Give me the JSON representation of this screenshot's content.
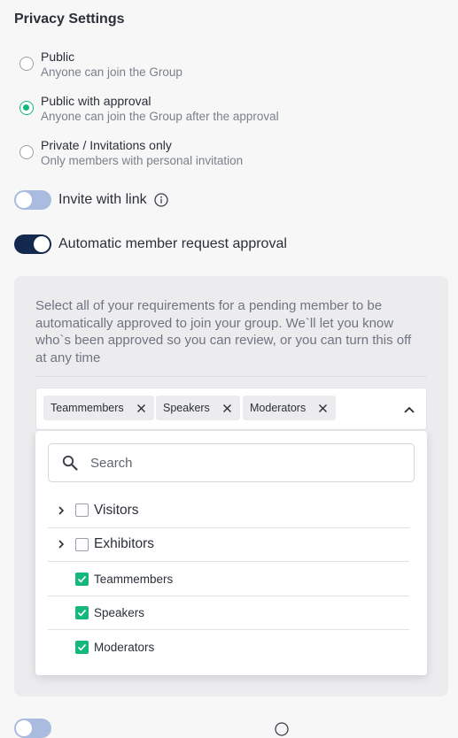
{
  "privacy": {
    "title": "Privacy Settings",
    "options": [
      {
        "title": "Public",
        "description": "Anyone can join the Group",
        "selected": false
      },
      {
        "title": "Public with approval",
        "description": "Anyone can join the Group after the approval",
        "selected": true
      },
      {
        "title": "Private / Invitations only",
        "description": "Only members with personal invitation",
        "selected": false
      }
    ]
  },
  "toggles": {
    "invite_with_link": {
      "label": "Invite with link",
      "on": false
    },
    "auto_approval": {
      "label": "Automatic member request approval",
      "on": true
    }
  },
  "approval_panel": {
    "description": "Select all of your requirements for a pending member to be automatically approved to join your group. We`ll let you know who`s been approved so you can review, or you can turn this off at any time",
    "selected_tags": [
      "Teammembers",
      "Speakers",
      "Moderators"
    ],
    "dropdown": {
      "search_placeholder": "Search",
      "items": [
        {
          "label": "Visitors",
          "checked": false,
          "expandable": true
        },
        {
          "label": "Exhibitors",
          "checked": false,
          "expandable": true
        },
        {
          "label": "Teammembers",
          "checked": true,
          "expandable": false
        },
        {
          "label": "Speakers",
          "checked": true,
          "expandable": false
        },
        {
          "label": "Moderators",
          "checked": true,
          "expandable": false
        }
      ]
    }
  },
  "colors": {
    "accent_green": "#14b87a",
    "toggle_on": "#13284f",
    "toggle_off": "#a9bce0"
  }
}
